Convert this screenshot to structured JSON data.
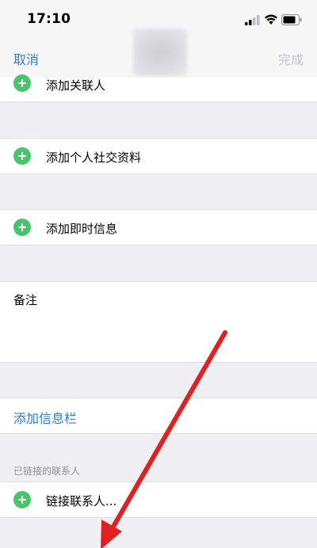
{
  "status_bar": {
    "time": "17:10",
    "icons": [
      "signal-icon",
      "wifi-icon",
      "battery-icon"
    ]
  },
  "nav": {
    "cancel_label": "取消",
    "done_label": "完成"
  },
  "rows": {
    "add_related": "添加关联人",
    "add_social": "添加个人社交资料",
    "add_im": "添加即时信息",
    "notes_label": "备注",
    "add_field": "添加信息栏",
    "linked_section_header": "已链接的联系人",
    "link_contacts": "链接联系人..."
  },
  "colors": {
    "accent": "#2f7fd0",
    "add_green": "#4bc36a",
    "annotation_arrow": "#e0211f",
    "background": "#efeff4"
  }
}
